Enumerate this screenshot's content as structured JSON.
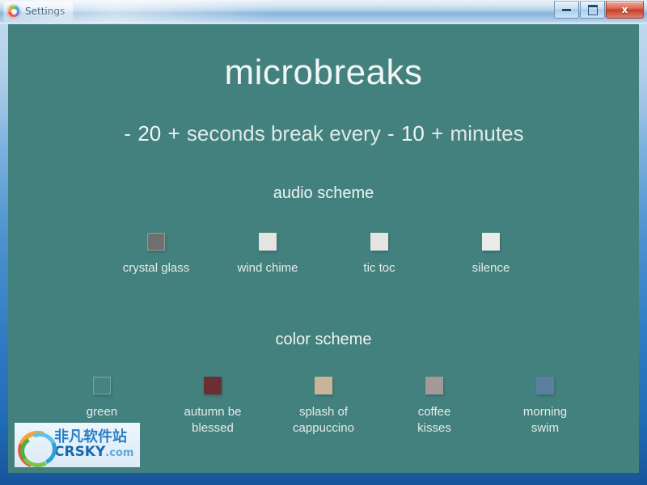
{
  "window": {
    "title": "Settings",
    "app_icon": "colorful-circle-icon",
    "buttons": {
      "minimize": "–",
      "maximize": "□",
      "close": "x"
    }
  },
  "app": {
    "title": "microbreaks",
    "background_color": "#43817e",
    "duration": {
      "minus": "-",
      "value": "20",
      "plus": "+",
      "unit": "seconds break every"
    },
    "interval": {
      "minus": "-",
      "value": "10",
      "plus": "+",
      "unit": "minutes"
    },
    "audio_section": {
      "heading": "audio scheme",
      "options": [
        {
          "label": "crystal glass",
          "color": "#6e7070",
          "selected": true
        },
        {
          "label": "wind chime",
          "color": "#e4e4e2",
          "selected": false
        },
        {
          "label": "tic toc",
          "color": "#e4e4e2",
          "selected": false
        },
        {
          "label": "silence",
          "color": "#ebebe9",
          "selected": false
        }
      ]
    },
    "color_section": {
      "heading": "color scheme",
      "options": [
        {
          "label": "green\nclouds",
          "color": "#46847f",
          "selected": true
        },
        {
          "label": "autumn be\nblessed",
          "color": "#6b2f33",
          "selected": false
        },
        {
          "label": "splash of\ncappuccino",
          "color": "#c9b49a",
          "selected": false
        },
        {
          "label": "coffee\nkisses",
          "color": "#a4989a",
          "selected": false
        },
        {
          "label": "morning\nswim",
          "color": "#5b7fa0",
          "selected": false
        }
      ]
    }
  },
  "watermark": {
    "chinese": "非凡软件站",
    "site": "CRSKY",
    "tld": ".com"
  }
}
